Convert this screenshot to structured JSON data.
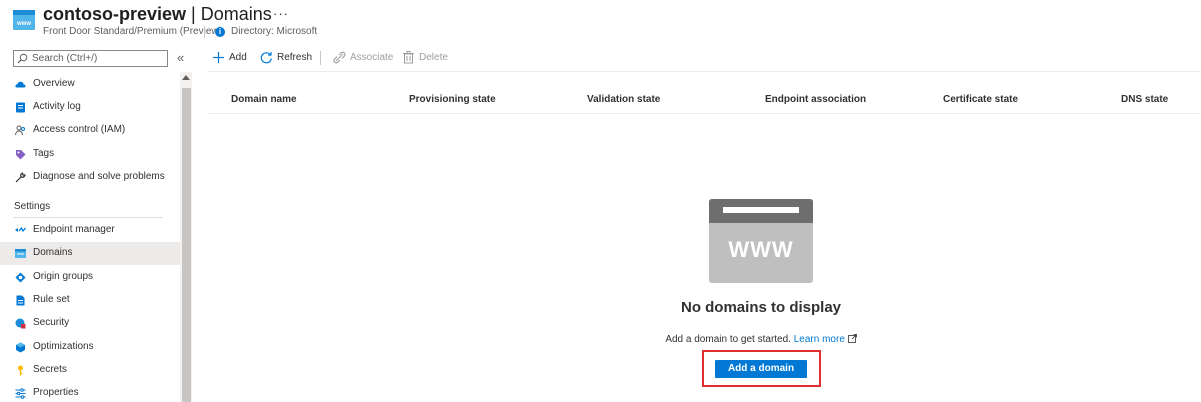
{
  "header": {
    "resource_name": "contoso-preview",
    "separator": " | ",
    "page_name": "Domains",
    "more": "···",
    "subtitle": "Front Door Standard/Premium (Preview)",
    "directory": "Directory: Microsoft",
    "info_glyph": "i"
  },
  "sidebar": {
    "search_placeholder": "Search (Ctrl+/)",
    "collapse_glyph": "«",
    "items": [
      {
        "label": "Overview",
        "icon": "cloud-icon"
      },
      {
        "label": "Activity log",
        "icon": "activity-log-icon"
      },
      {
        "label": "Access control (IAM)",
        "icon": "people-icon"
      },
      {
        "label": "Tags",
        "icon": "tag-icon"
      },
      {
        "label": "Diagnose and solve problems",
        "icon": "wrench-icon"
      }
    ],
    "section_settings": "Settings",
    "settings_items": [
      {
        "label": "Endpoint manager",
        "icon": "endpoint-icon"
      },
      {
        "label": "Domains",
        "icon": "domain-icon",
        "active": true
      },
      {
        "label": "Origin groups",
        "icon": "origin-groups-icon"
      },
      {
        "label": "Rule set",
        "icon": "rule-set-icon"
      },
      {
        "label": "Security",
        "icon": "security-icon"
      },
      {
        "label": "Optimizations",
        "icon": "optimizations-icon"
      },
      {
        "label": "Secrets",
        "icon": "key-icon"
      },
      {
        "label": "Properties",
        "icon": "properties-icon"
      }
    ]
  },
  "toolbar": {
    "add": "Add",
    "refresh": "Refresh",
    "associate": "Associate",
    "delete": "Delete"
  },
  "table": {
    "columns": [
      "Domain name",
      "Provisioning state",
      "Validation state",
      "Endpoint association",
      "Certificate state",
      "DNS state"
    ]
  },
  "empty_state": {
    "image_text": "WWW",
    "title": "No domains to display",
    "description": "Add a domain to get started.",
    "learn_more": "Learn more",
    "button": "Add a domain"
  },
  "colors": {
    "accent": "#0078d4",
    "highlight": "#e0302f",
    "disabled_text": "#a19f9d",
    "active_nav": "#edebe9"
  }
}
